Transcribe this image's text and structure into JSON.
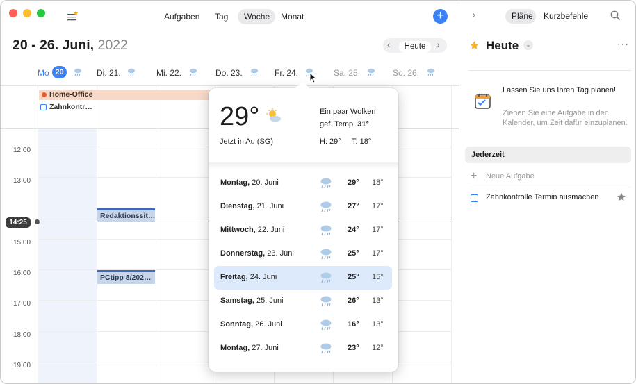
{
  "toolbar": {
    "tasks": "Aufgaben",
    "day": "Tag",
    "week": "Woche",
    "month": "Monat"
  },
  "calendar": {
    "title_range": "20 - 26. Juni,",
    "title_year": "2022",
    "today_button": "Heute",
    "days": [
      {
        "label": "Mo",
        "num": "20"
      },
      {
        "label": "Di. 21."
      },
      {
        "label": "Mi. 22."
      },
      {
        "label": "Do. 23."
      },
      {
        "label": "Fr. 24."
      },
      {
        "label": "Sa. 25."
      },
      {
        "label": "So. 26."
      }
    ],
    "allday": {
      "home_office": "Home-Office",
      "zahn": "Zahnkontr…"
    },
    "times": [
      "12:00",
      "13:00",
      "14:25",
      "15:00",
      "16:00",
      "17:00",
      "18:00",
      "19:00"
    ],
    "events": {
      "redaktion": "Redaktionssit…",
      "pctipp": "PCtipp 8/202…"
    }
  },
  "popover": {
    "temp": "29°",
    "desc": "Ein paar Wolken",
    "felt_label": "gef. Temp.",
    "felt": "31°",
    "location": "Jetzt in Au (SG)",
    "high": "H: 29°",
    "low": "T: 18°",
    "forecast": [
      {
        "day": "Montag,",
        "date": "20. Juni",
        "hi": "29°",
        "lo": "18°"
      },
      {
        "day": "Dienstag,",
        "date": "21. Juni",
        "hi": "27°",
        "lo": "17°"
      },
      {
        "day": "Mittwoch,",
        "date": "22. Juni",
        "hi": "24°",
        "lo": "17°"
      },
      {
        "day": "Donnerstag,",
        "date": "23. Juni",
        "hi": "25°",
        "lo": "17°"
      },
      {
        "day": "Freitag,",
        "date": "24. Juni",
        "hi": "25°",
        "lo": "15°"
      },
      {
        "day": "Samstag,",
        "date": "25. Juni",
        "hi": "26°",
        "lo": "13°"
      },
      {
        "day": "Sonntag,",
        "date": "26. Juni",
        "hi": "16°",
        "lo": "13°"
      },
      {
        "day": "Montag,",
        "date": "27. Juni",
        "hi": "23°",
        "lo": "12°"
      }
    ]
  },
  "sidebar": {
    "tab_plans": "Pläne",
    "tab_shortcuts": "Kurzbefehle",
    "title": "Heute",
    "plan_title": "Lassen Sie uns Ihren Tag planen!",
    "plan_desc": "Ziehen Sie eine Aufgabe in den Kalender, um Zeit dafür einzuplanen.",
    "section": "Jederzeit",
    "new_task": "Neue Aufgabe",
    "task": "Zahnkontrolle Termin ausmachen"
  },
  "colors": {
    "accent": "#3b82f6",
    "today_bg": "#eef3fc",
    "allday_event": "#f8d8c7",
    "selected_row": "#ddeafc"
  }
}
